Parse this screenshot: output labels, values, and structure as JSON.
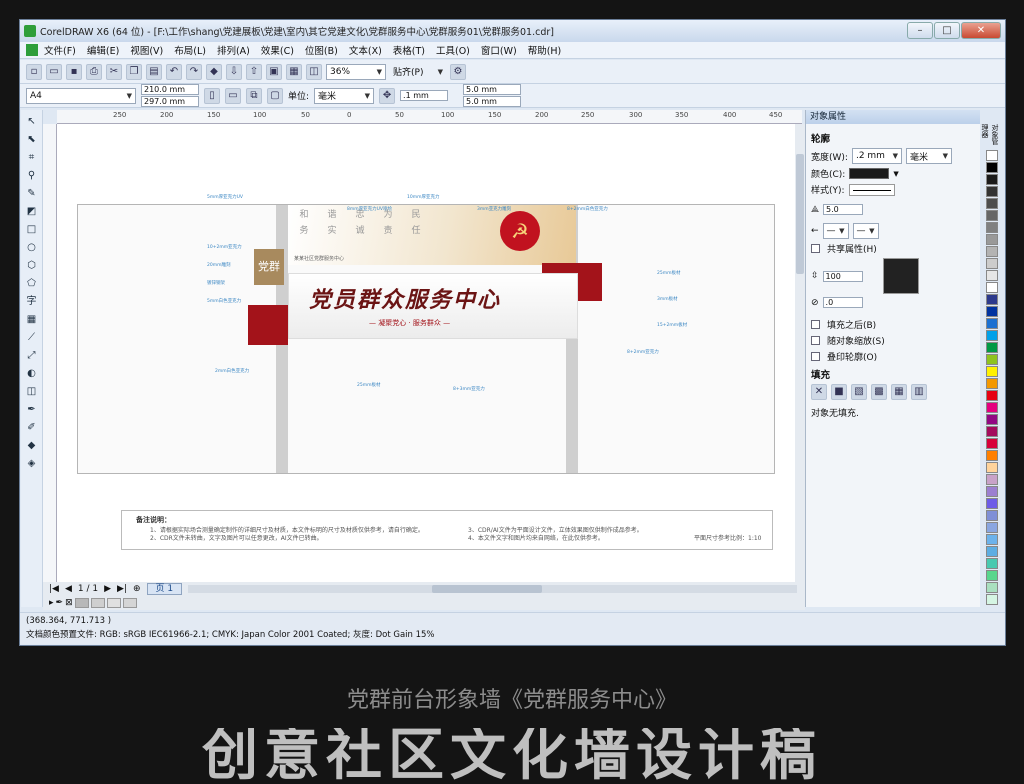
{
  "window": {
    "title": "CorelDRAW X6 (64 位) - [F:\\工作\\shang\\党建展板\\党建\\室内\\其它党建文化\\党群服务中心\\党群服务01\\党群服务01.cdr]",
    "controls": {
      "minimize": "–",
      "maximize": "□",
      "close": "✕"
    }
  },
  "menu": [
    "文件(F)",
    "编辑(E)",
    "视图(V)",
    "布局(L)",
    "排列(A)",
    "效果(C)",
    "位图(B)",
    "文本(X)",
    "表格(T)",
    "工具(O)",
    "窗口(W)",
    "帮助(H)"
  ],
  "toolbar": {
    "zoom": "36%",
    "snap": "贴齐(P)"
  },
  "property_bar": {
    "page_size": "A4",
    "width": "210.0 mm",
    "height": "297.0 mm",
    "units_label": "单位:",
    "units": "毫米",
    "nudge": ".1 mm",
    "dup_x": "5.0 mm",
    "dup_y": "5.0 mm"
  },
  "ruler": {
    "ticks": [
      "250",
      "200",
      "150",
      "100",
      "50",
      "0",
      "50",
      "100",
      "150",
      "200",
      "250",
      "300",
      "350",
      "400",
      "450"
    ]
  },
  "design": {
    "title": "党员群众服务中心",
    "slogan": "— 凝聚党心 · 服务群众 —",
    "badge": "党群",
    "chars_top": [
      "和",
      "谐",
      "忠",
      "为",
      "民"
    ],
    "chars_bottom": [
      "务",
      "实",
      "诚",
      "责",
      "任"
    ],
    "sub_org": "某某社区党群服务中心"
  },
  "annotations": [
    "5mm厚亚克力UV",
    "8mm厚亚克力UV喷绘",
    "10mm厚亚克力",
    "3mm亚克力雕刻",
    "8+2mm白色亚克力",
    "10+2mm亚克力",
    "20mm雕刻",
    "镀锌钢架",
    "5mm白色亚克力",
    "25mm板材",
    "3mm板材",
    "15+2mm板材",
    "8+2mm亚克力",
    "2mm白色亚克力",
    "25mm板材",
    "8+3mm亚克力"
  ],
  "notes": {
    "heading": "备注说明：",
    "items": [
      "1、请根据实际场合测量确定制作的详细尺寸及材质，本文件标明的尺寸及材质仅供参考，请自行确定。",
      "2、CDR文件未转曲，文字及图片可以任意更改，AI文件已转曲。",
      "3、CDR/AI文件为平面设计文件，立体效果图仅供制作成品参考。",
      "4、本文件文字和图片均来自网络，在此仅供参考。"
    ],
    "scale": "平面尺寸参考比例：1:10"
  },
  "pagebar": {
    "current": "1 / 1",
    "tab": "页 1"
  },
  "status": {
    "coords": "(368.364, 771.713 )",
    "profile": "文档颜色预置文件: RGB: sRGB IEC61966-2.1; CMYK: Japan Color 2001 Coated; 灰度: Dot Gain 15%"
  },
  "docker": {
    "title": "对象属性",
    "outline_section": "轮廓",
    "width_label": "宽度(W):",
    "width_value": ".2 mm",
    "width_unit": "毫米",
    "color_label": "颜色(C):",
    "style_label": "样式(Y):",
    "miter": "5.0",
    "share_attr": "共享属性(H)",
    "stretch_pct": "100",
    "angle": ".0",
    "fill_behind": "填充之后(B)",
    "scale_with": "随对象缩放(S)",
    "overprint": "叠印轮廓(O)",
    "fill_section": "填充",
    "fill_status": "对象无填充."
  },
  "side_tabs": [
    "对象管理器",
    "对象属性",
    "变换"
  ],
  "caption": "党群前台形象墙《党群服务中心》",
  "caption_big": "创意社区文化墙设计稿",
  "palette_colors": [
    "#ffffff",
    "#000000",
    "#1a1a1a",
    "#333333",
    "#4d4d4d",
    "#666666",
    "#808080",
    "#999999",
    "#b3b3b3",
    "#cccccc",
    "#e6e6e6",
    "#ffffff",
    "#2d3a8c",
    "#0033a0",
    "#1a6fd1",
    "#00a0e9",
    "#009944",
    "#8fc31f",
    "#fff100",
    "#f39800",
    "#e60012",
    "#e4007f",
    "#920783",
    "#a40b5d",
    "#d7003a",
    "#ff7f00",
    "#ffd39b",
    "#c8a2c8",
    "#9b7fd0",
    "#6c5ce7",
    "#7f8fd6",
    "#8aa6e0",
    "#6cb2eb",
    "#5dade2",
    "#48c9b0",
    "#58d68d",
    "#a9dfbf",
    "#d5f5e3",
    "#f9e79f",
    "#fad7a0",
    "#f5cba7",
    "#edbb99",
    "#d7ccc8",
    "#bcaaa4",
    "#a1887f",
    "#8d6e63",
    "#795548",
    "#5d4037"
  ]
}
